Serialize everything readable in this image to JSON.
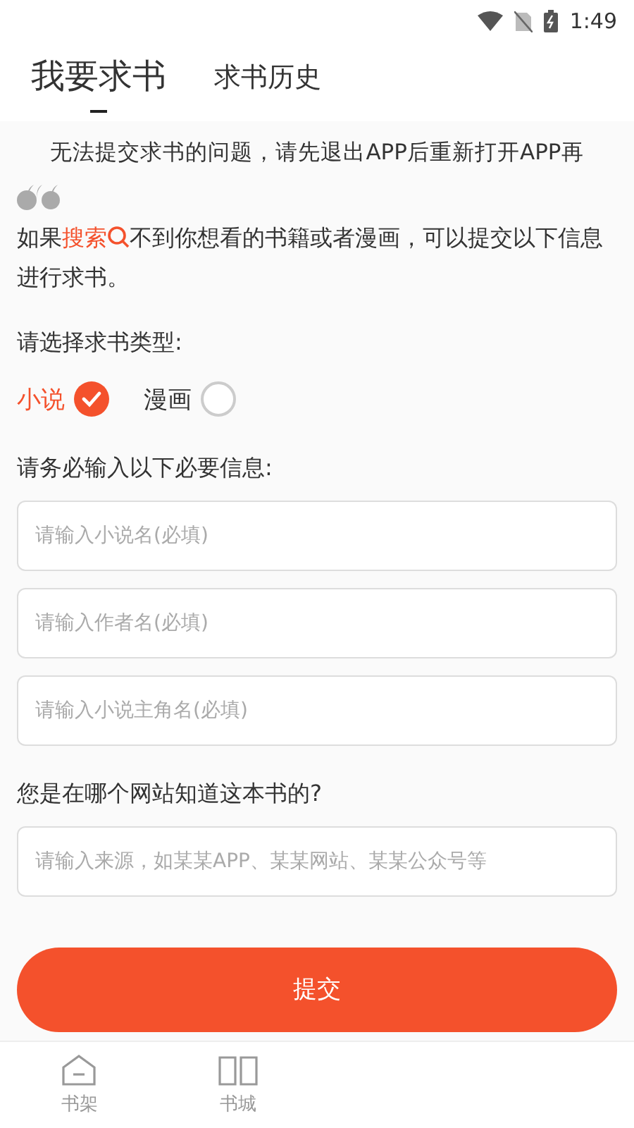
{
  "status_bar": {
    "time": "1:49"
  },
  "tabs": [
    {
      "label": "我要求书",
      "selected": true
    },
    {
      "label": "求书历史",
      "selected": false
    }
  ],
  "notice": "无法提交求书的问题，请先退出APP后重新打开APP再",
  "intro": {
    "before": "如果",
    "link": "搜索",
    "after": "不到你想看的书籍或者漫画，可以提交以下信息进行求书。"
  },
  "type_label": "请选择求书类型:",
  "types": [
    {
      "label": "小说",
      "selected": true
    },
    {
      "label": "漫画",
      "selected": false
    }
  ],
  "required_label": "请务必输入以下必要信息:",
  "required_fields": [
    {
      "placeholder": "请输入小说名(必填)"
    },
    {
      "placeholder": "请输入作者名(必填)"
    },
    {
      "placeholder": "请输入小说主角名(必填)"
    }
  ],
  "source_label": "您是在哪个网站知道这本书的?",
  "source_field": {
    "placeholder": "请输入来源，如某某APP、某某网站、某某公众号等"
  },
  "submit": "提交",
  "bottom_nav": [
    {
      "label": "书架",
      "kind": "shelf"
    },
    {
      "label": "书城",
      "kind": "store"
    }
  ]
}
